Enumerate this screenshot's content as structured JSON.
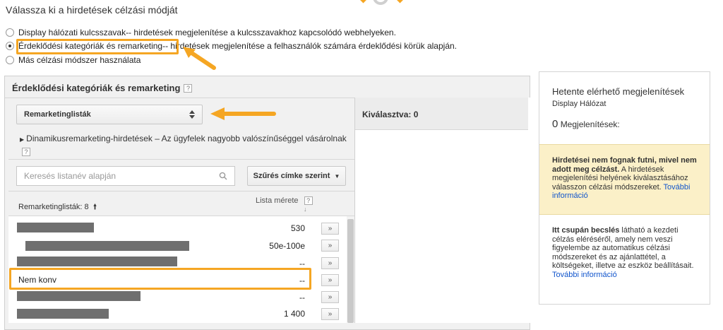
{
  "page": {
    "heading": "Válassza ki a hirdetések célzási módját"
  },
  "targeting_options": [
    {
      "title": "Display hálózati kulcsszavak",
      "desc": " -- hirdetések megjelenítése a kulcsszavakhoz kapcsolódó webhelyeken.",
      "selected": false
    },
    {
      "title": "Érdeklődési kategóriák és remarketing",
      "desc": " -- hirdetések megjelenítése a felhasználók számára érdeklődési körük alapján.",
      "selected": true
    },
    {
      "title": "Más célzási módszer használata",
      "desc": "",
      "selected": false
    }
  ],
  "panel": {
    "title": "Érdeklődési kategóriák és remarketing",
    "help": "?",
    "select_value": "Remarketinglisták",
    "select_icon": "updown-arrows-icon",
    "dynamic_title": "Dinamikusremarketing-hirdetések",
    "dynamic_desc": " – Az ügyfelek nagyobb valószínűséggel vásárolnak",
    "search_placeholder": "Keresés listanév alapján",
    "filter_label": "Szűrés címke szerint",
    "list_header": "Remarketinglisták: 8",
    "size_header": "Lista mérete",
    "add_label": "»",
    "rows": [
      {
        "name": "",
        "size": "530"
      },
      {
        "name": "",
        "size": "50e-100e"
      },
      {
        "name": "",
        "size": "--"
      },
      {
        "name": "Nem konv",
        "size": "--"
      },
      {
        "name": "",
        "size": "--"
      },
      {
        "name": "",
        "size": "1 400"
      }
    ]
  },
  "selected_pane": {
    "label": "Kiválasztva: 0"
  },
  "sidebar": {
    "title": "Hetente elérhető megjelenítések",
    "subtitle": "Display Hálózat",
    "count": "0",
    "count_label": "Megjelenítések:",
    "warning_bold": "Hirdetései nem fognak futni, mivel nem adott meg célzást.",
    "warning_text": " A hirdetések megjelenítési helyének kiválasztásához válasszon célzási módszereket.",
    "warning_link": "További információ",
    "estimate_bold": "Itt csupán becslés",
    "estimate_text": " látható a kezdeti célzás eléréséről, amely nem veszi figyelembe az automatikus célzási módszereket és az ajánlattétel, a költségeket, illetve az eszköz beállításait.",
    "estimate_link": "További információ"
  },
  "colors": {
    "highlight": "#f5a623",
    "link": "#1155cc",
    "warning_bg": "#fbf0c8"
  }
}
